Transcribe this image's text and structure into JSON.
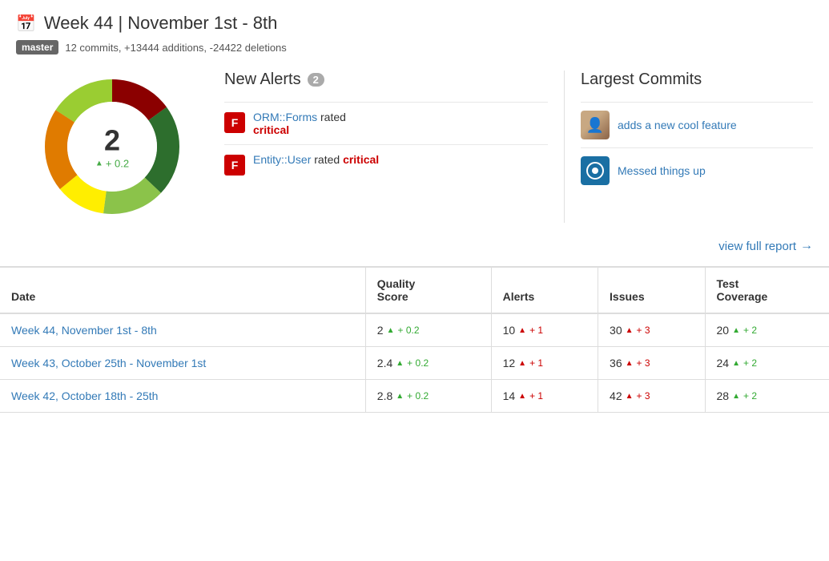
{
  "header": {
    "icon": "📅",
    "title": "Week 44 | November 1st - 8th",
    "branch": "master",
    "meta": "12 commits, +13444 additions, -24422 deletions"
  },
  "donut": {
    "score": "2",
    "delta": "+ 0.2"
  },
  "alerts": {
    "title": "New Alerts",
    "count": "2",
    "items": [
      {
        "grade": "F",
        "link_text": "ORM::Forms",
        "text_after": " rated",
        "severity": "critical"
      },
      {
        "grade": "F",
        "link_text": "Entity::User",
        "text_after": " rated ",
        "severity": "critical"
      }
    ]
  },
  "commits": {
    "title": "Largest Commits",
    "items": [
      {
        "type": "photo",
        "link_text": "adds a new cool feature"
      },
      {
        "type": "icon",
        "link_text": "Messed things up"
      }
    ]
  },
  "view_report": "view full report",
  "table": {
    "columns": [
      "Date",
      "Quality\nScore",
      "Alerts",
      "Issues",
      "Test\nCoverage"
    ],
    "col_headers": [
      "Date",
      "Quality Score",
      "Alerts",
      "Issues",
      "Test Coverage"
    ],
    "rows": [
      {
        "date": "Week 44, November 1st - 8th",
        "score": "2",
        "score_delta": "+ 0.2",
        "alerts": "10",
        "alerts_delta": "+ 1",
        "issues": "30",
        "issues_delta": "+ 3",
        "coverage": "20",
        "coverage_delta": "+ 2"
      },
      {
        "date": "Week 43, October 25th - November 1st",
        "score": "2.4",
        "score_delta": "+ 0.2",
        "alerts": "12",
        "alerts_delta": "+ 1",
        "issues": "36",
        "issues_delta": "+ 3",
        "coverage": "24",
        "coverage_delta": "+ 2"
      },
      {
        "date": "Week 42, October 18th - 25th",
        "score": "2.8",
        "score_delta": "+ 0.2",
        "alerts": "14",
        "alerts_delta": "+ 1",
        "issues": "42",
        "issues_delta": "+ 3",
        "coverage": "28",
        "coverage_delta": "+ 2"
      }
    ]
  }
}
